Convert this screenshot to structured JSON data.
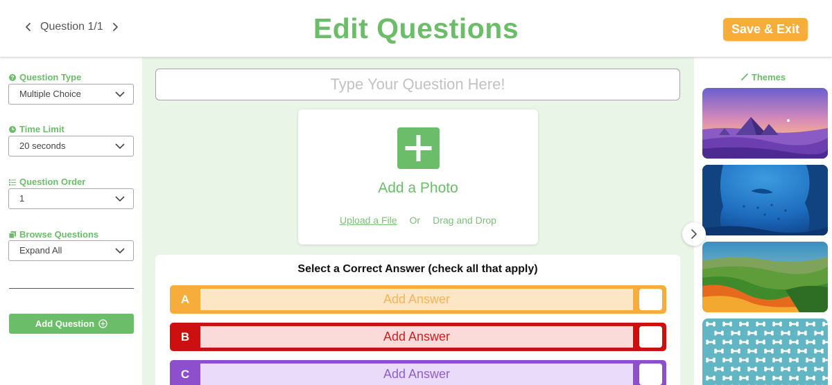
{
  "header": {
    "question_counter": "Question 1/1",
    "title": "Edit Questions",
    "save_exit_label": "Save & Exit"
  },
  "sidebar": {
    "question_type": {
      "label": "Question Type",
      "value": "Multiple Choice"
    },
    "time_limit": {
      "label": "Time Limit",
      "value": "20 seconds"
    },
    "question_order": {
      "label": "Question Order",
      "value": "1"
    },
    "browse_questions": {
      "label": "Browse Questions",
      "value": "Expand All"
    },
    "add_question_label": "Add Question"
  },
  "main": {
    "question_placeholder": "Type Your Question Here!",
    "photo": {
      "title": "Add a Photo",
      "upload_link": "Upload a File",
      "or_text": "Or",
      "drag_text": "Drag and Drop"
    },
    "answers_title": "Select a Correct Answer (check all that apply)",
    "answers": [
      {
        "letter": "A",
        "placeholder": "Add Answer",
        "color": "#f6ad3c",
        "field_bg": "#fde6c3",
        "text_color": "#f6b45a"
      },
      {
        "letter": "B",
        "placeholder": "Add Answer",
        "color": "#cc1010",
        "field_bg": "#fbdada",
        "text_color": "#cc2222"
      },
      {
        "letter": "C",
        "placeholder": "Add Answer",
        "color": "#8d4fcb",
        "field_bg": "#eadbfb",
        "text_color": "#8d5fcb"
      }
    ]
  },
  "themes": {
    "label": "Themes",
    "items": [
      "desert-pyramids-theme",
      "underwater-theme",
      "green-hills-theme",
      "dog-bones-pattern-theme"
    ]
  },
  "colors": {
    "brand_green": "#6cbd6a",
    "accent_orange": "#f6ad3c",
    "background_green": "#e9f5e7"
  }
}
